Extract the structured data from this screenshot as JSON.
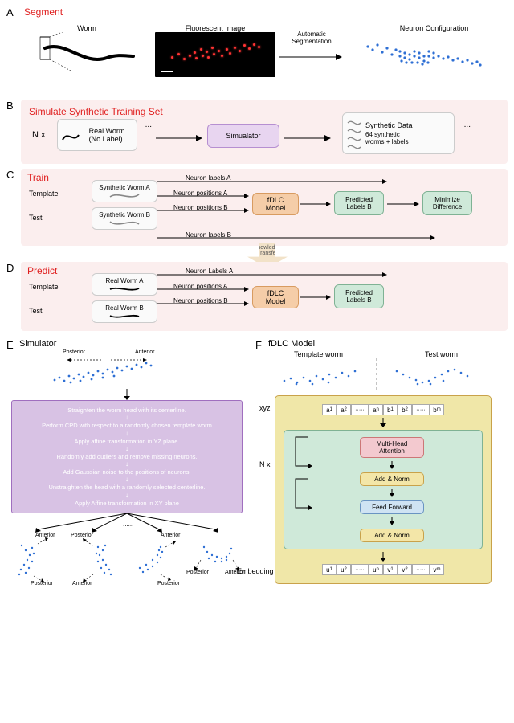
{
  "panelLetters": {
    "A": "A",
    "B": "B",
    "C": "C",
    "D": "D",
    "E": "E",
    "F": "F"
  },
  "A": {
    "title": "Segment",
    "worm": "Worm",
    "fluor": "Fluorescent Image",
    "autoSeg": "Automatic\nSegmentation",
    "neuronConfig": "Neuron Configuration"
  },
  "B": {
    "title": "Simulate Synthetic Training Set",
    "nx": "N x",
    "realWorm": "Real Worm\n(No Label)",
    "simulator": "Simualator",
    "syntheticData": "Synthetic Data",
    "syntheticDesc": "64 synthetic\nworms + labels"
  },
  "C": {
    "title": "Train",
    "template": "Template",
    "test": "Test",
    "wormA": "Synthetic Worm A",
    "wormB": "Synthetic Worm B",
    "labelsA": "Neuron labels A",
    "posA": "Neuron positions A",
    "posB": "Neuron positions B",
    "labelsB": "Neuron labels B",
    "model": "fDLC Model",
    "predB": "Predicted\nLabels B",
    "minimize": "Minimize\nDifference",
    "knowledge": "Knowledge\nTransfer"
  },
  "D": {
    "title": "Predict",
    "template": "Template",
    "test": "Test",
    "wormA": "Real Worm A",
    "wormB": "Real Worm B",
    "labelsA": "Neuron Labels A",
    "posA": "Neuron positions A",
    "posB": "Neuron positions B",
    "model": "fDLC Model",
    "predB": "Predicted\nLabels B"
  },
  "E": {
    "title": "Simulator",
    "posterior": "Posterior",
    "anterior": "Anterior",
    "steps": [
      "Straighten the worm head with its centerline.",
      "Perform CPD with respect to a randomly chosen template worm",
      "Apply affine transformation in YZ plane.",
      "Randomly add outliers and remove missing neurons.",
      "Add Gaussian noise to the positions of neurons.",
      "Unstraighten the head with a randomly selected centerline.",
      "Apply Affine transformation in XY plane"
    ]
  },
  "F": {
    "title": "fDLC Model",
    "templateWorm": "Template worm",
    "testWorm": "Test worm",
    "xyz": "xyz",
    "nx": "N x",
    "mha": "Multi-Head\nAttention",
    "addnorm": "Add & Norm",
    "ff": "Feed Forward",
    "embedding": "Embedding",
    "cells_a": [
      "a",
      "a",
      "a"
    ],
    "cells_b": [
      "b",
      "b",
      "b"
    ],
    "cells_u": [
      "u",
      "u",
      "u"
    ],
    "cells_v": [
      "v",
      "v",
      "v"
    ]
  }
}
